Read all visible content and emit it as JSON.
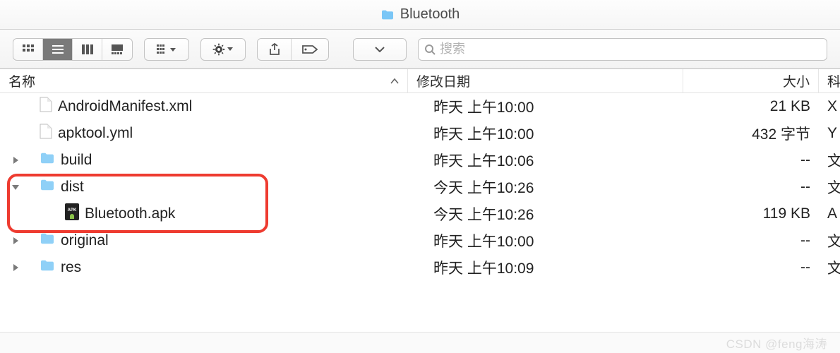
{
  "window": {
    "title": "Bluetooth"
  },
  "search": {
    "placeholder": "搜索"
  },
  "columns": {
    "name": "名称",
    "date": "修改日期",
    "size": "大小",
    "kind": "科"
  },
  "files": [
    {
      "name": "AndroidManifest.xml",
      "date": "昨天 上午10:00",
      "size": "21 KB",
      "kind": "X",
      "icon": "file",
      "level": 0,
      "disclosure": ""
    },
    {
      "name": "apktool.yml",
      "date": "昨天 上午10:00",
      "size": "432 字节",
      "kind": "Y",
      "icon": "file",
      "level": 0,
      "disclosure": ""
    },
    {
      "name": "build",
      "date": "昨天 上午10:06",
      "size": "--",
      "kind": "文",
      "icon": "folder",
      "level": 0,
      "disclosure": "right"
    },
    {
      "name": "dist",
      "date": "今天 上午10:26",
      "size": "--",
      "kind": "文",
      "icon": "folder",
      "level": 0,
      "disclosure": "down"
    },
    {
      "name": "Bluetooth.apk",
      "date": "今天 上午10:26",
      "size": "119 KB",
      "kind": "A",
      "icon": "apk",
      "level": 1,
      "disclosure": ""
    },
    {
      "name": "original",
      "date": "昨天 上午10:00",
      "size": "--",
      "kind": "文",
      "icon": "folder",
      "level": 0,
      "disclosure": "right"
    },
    {
      "name": "res",
      "date": "昨天 上午10:09",
      "size": "--",
      "kind": "文",
      "icon": "folder",
      "level": 0,
      "disclosure": "right"
    }
  ],
  "watermark": "CSDN @feng海涛",
  "icons": {
    "view_icon": "icon-view",
    "view_list": "list-view",
    "view_column": "column-view",
    "view_gallery": "gallery-view",
    "group": "group-by",
    "action": "action-menu",
    "share": "share",
    "tag": "tag",
    "path": "path-dropdown",
    "search": "search"
  }
}
